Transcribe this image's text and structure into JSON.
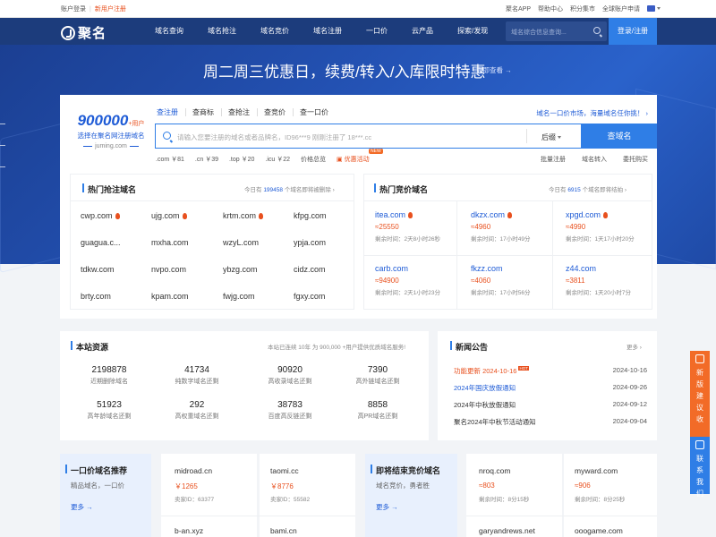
{
  "topbar": {
    "login": "账户登录",
    "register": "新用户注册",
    "right_links": [
      "聚名APP",
      "帮助中心",
      "积分集市",
      "全球账户申请"
    ]
  },
  "nav": {
    "logo": "聚名",
    "links": [
      "域名查询",
      "域名抢注",
      "域名竞价",
      "域名注册",
      "一口价",
      "云产品",
      "探索/发现"
    ],
    "search_placeholder": "域名综合信息查询...",
    "login_button": "登录/注册"
  },
  "banner": {
    "promo": "周二周三优惠日，续费/转入/入库限时特惠",
    "promo_link": "立即查看 →"
  },
  "search": {
    "count": "900000",
    "count_suffix": "+用户",
    "subtitle": "选择在聚名网注册域名",
    "site": "juming.com",
    "tabs": [
      "查注册",
      "查商标",
      "查抢注",
      "查竞价",
      "查一口价"
    ],
    "market_link": "域名一口价市场，海量域名任你挑！",
    "placeholder": "请输入您要注册的域名或者品牌名，ID96***9 刚刚注册了 18***.cc",
    "suffix": "后缀",
    "button": "查域名",
    "ext_prices": [
      ".com ￥81",
      ".cn ￥39",
      ".top ￥20",
      ".icu ￥22",
      "价格总览",
      "优惠活动"
    ],
    "new_tag": "NEW",
    "right_links": [
      "批量注册",
      "域名转入",
      "委托购买"
    ]
  },
  "hot_snipe": {
    "title": "热门抢注域名",
    "note_prefix": "今日有",
    "note_count": "199458",
    "note_suffix": "个域名即将被删除",
    "domains": [
      "cwp.com",
      "ujg.com",
      "krtm.com",
      "kfpg.com",
      "guagua.c...",
      "mxha.com",
      "wzyL.com",
      "ypja.com",
      "tdkw.com",
      "nvpo.com",
      "ybzg.com",
      "cidz.com",
      "brty.com",
      "kpam.com",
      "fwjg.com",
      "fgxy.com"
    ]
  },
  "hot_auction": {
    "title": "热门竞价域名",
    "note_prefix": "今日有",
    "note_count": "6915",
    "note_suffix": "个域名即将结拍",
    "items": [
      {
        "domain": "itea.com",
        "price": "≈25550",
        "time": "剩余时间：2天8小时26秒"
      },
      {
        "domain": "dkzx.com",
        "price": "≈4960",
        "time": "剩余时间：17小时49分"
      },
      {
        "domain": "xpgd.com",
        "price": "≈4990",
        "time": "剩余时间：1天17小时20分"
      },
      {
        "domain": "carb.com",
        "price": "≈94900",
        "time": "剩余时间：2天1小时23分"
      },
      {
        "domain": "fkzz.com",
        "price": "≈4060",
        "time": "剩余时间：17小时56分"
      },
      {
        "domain": "z44.com",
        "price": "≈3811",
        "time": "剩余时间：1天20小时7分"
      }
    ]
  },
  "resources": {
    "title": "本站资源",
    "note": "本站已连续 10年 为 900,000 +用户提供优质域名服务!",
    "stats": [
      {
        "value": "2198878",
        "label": "近期删除域名"
      },
      {
        "value": "41734",
        "label": "纯数字域名还剩"
      },
      {
        "value": "90920",
        "label": "高收录域名还剩"
      },
      {
        "value": "7390",
        "label": "高外链域名还剩"
      },
      {
        "value": "51923",
        "label": "高年龄域名还剩"
      },
      {
        "value": "292",
        "label": "高权重域名还剩"
      },
      {
        "value": "38783",
        "label": "百度高反链还剩"
      },
      {
        "value": "8858",
        "label": "高PR域名还剩"
      }
    ]
  },
  "news": {
    "title": "新闻公告",
    "more": "更多",
    "hot_tag": "HOT",
    "items": [
      {
        "title": "功能更新 2024-10-16",
        "date": "2024-10-16",
        "color": "#e8501e"
      },
      {
        "title": "2024年国庆放假通知",
        "date": "2024-09-26",
        "color": "#1e5bd6"
      },
      {
        "title": "2024年中秋放假通知",
        "date": "2024-09-12",
        "color": "#333333"
      },
      {
        "title": "聚名2024年中秋节活动通知",
        "date": "2024-09-04",
        "color": "#333333"
      }
    ]
  },
  "fixed_price": {
    "title": "一口价域名推荐",
    "subtitle": "精品域名，一口价",
    "more": "更多 →",
    "items": [
      {
        "domain": "midroad.cn",
        "price": "￥1265",
        "seller": "卖家ID：63377"
      },
      {
        "domain": "taomi.cc",
        "price": "￥8776",
        "seller": "卖家ID：55582"
      },
      {
        "domain": "b-an.xyz"
      },
      {
        "domain": "bami.cn"
      }
    ]
  },
  "ending_auction": {
    "title": "即将结束竞价域名",
    "subtitle": "域名竞价，勇者胜",
    "more": "更多 →",
    "items": [
      {
        "domain": "nroq.com",
        "price": "≈803",
        "time": "剩余时间：8分15秒"
      },
      {
        "domain": "myward.com",
        "price": "≈906",
        "time": "剩余时间：8分25秒"
      },
      {
        "domain": "garyandrews.net"
      },
      {
        "domain": "ooogame.com"
      }
    ]
  },
  "side": {
    "feedback": [
      "新",
      "版",
      "建",
      "议",
      "收",
      "集"
    ],
    "contact": [
      "联",
      "系",
      "我",
      "们"
    ]
  }
}
